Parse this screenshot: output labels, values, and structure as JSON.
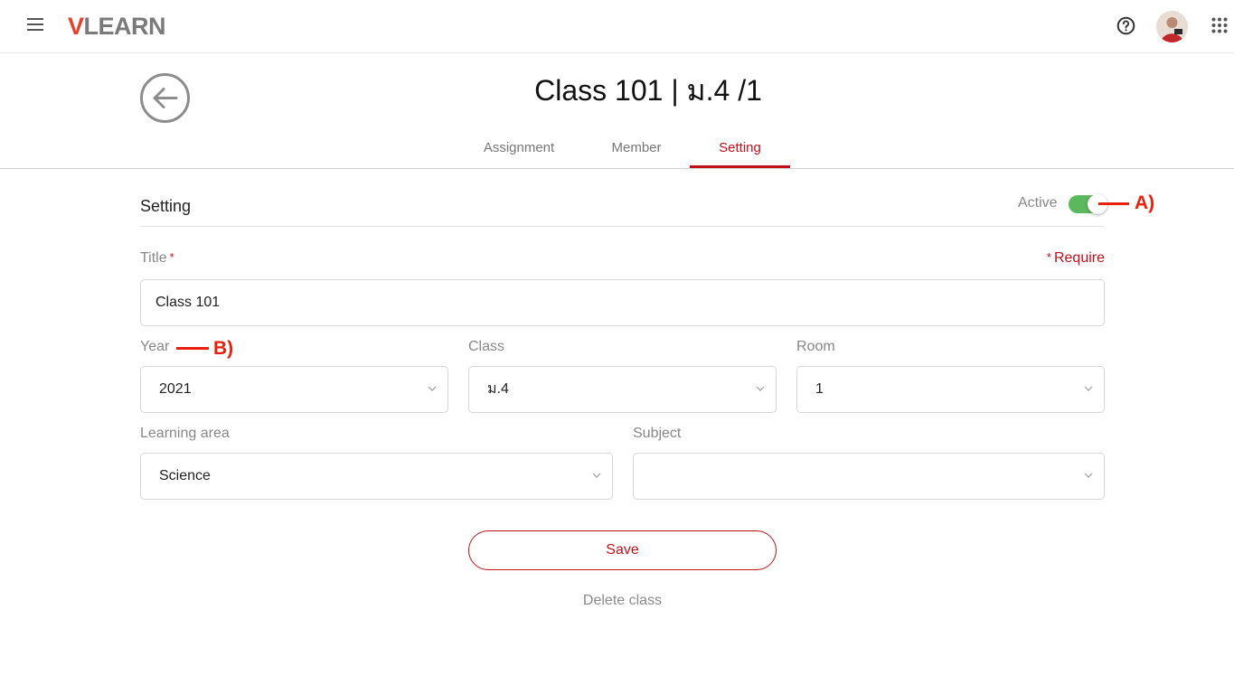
{
  "header": {
    "logo_v": "V",
    "logo_rest": "LEARN",
    "menu_icon": "hamburger-icon",
    "help_icon": "help-circle-icon",
    "apps_icon": "apps-grid-icon"
  },
  "page": {
    "title": "Class 101 | ม.4 /1",
    "back_icon": "arrow-left-circle-icon"
  },
  "tabs": [
    {
      "label": "Assignment",
      "active": false
    },
    {
      "label": "Member",
      "active": false
    },
    {
      "label": "Setting",
      "active": true
    }
  ],
  "settings": {
    "section_title": "Setting",
    "active_label": "Active",
    "active_on": true,
    "require_note": "Require",
    "title_label": "Title",
    "title_value": "Class 101",
    "year_label": "Year",
    "year_value": "2021",
    "class_label": "Class",
    "class_value": "ม.4",
    "room_label": "Room",
    "room_value": "1",
    "learning_area_label": "Learning area",
    "learning_area_value": "Science",
    "subject_label": "Subject",
    "subject_value": "",
    "save_label": "Save",
    "delete_label": "Delete class"
  },
  "annotations": {
    "a": "A)",
    "b": "B)"
  },
  "colors": {
    "accent": "#c0101a",
    "toggle_on": "#5cb85c",
    "annotation": "#e8200d"
  }
}
